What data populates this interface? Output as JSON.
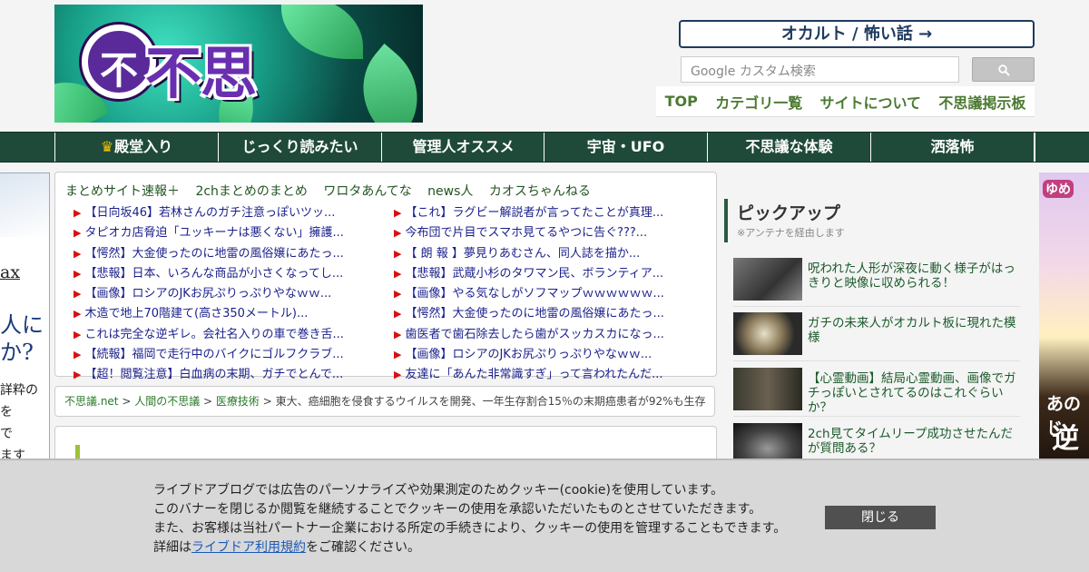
{
  "header": {
    "logo_text": "不思議.NET",
    "logo_glyph": "不",
    "occult_button": "オカルト / 怖い話 →",
    "search_placeholder": "Google カスタム検索",
    "topnav": [
      "TOP",
      "カテゴリ一覧",
      "サイトについて",
      "不思議掲示板"
    ]
  },
  "mainnav": [
    "殿堂入り",
    "じっくり読みたい",
    "管理人オススメ",
    "宇宙・UFO",
    "不思議な体験",
    "洒落怖"
  ],
  "left_ad": {
    "lines": [
      "ax",
      "人に",
      "か?",
      "詳粋の",
      "を",
      "で",
      "ます"
    ]
  },
  "antenna": {
    "tabs": [
      "まとめサイト速報＋",
      "2chまとめのまとめ",
      "ワロタあんてな",
      "news人",
      "カオスちゃんねる"
    ],
    "left": [
      "【日向坂46】若林さんのガチ注意っぽいツッ...",
      "タピオカ店脅迫「ユッキーナは悪くない」擁護...",
      "【愕然】大金使ったのに地雷の風俗嬢にあたっ...",
      "【悲報】日本、いろんな商品が小さくなってし...",
      "【画像】ロシアのJKお尻ぷりっぷりやなｗｗ...",
      "木造で地上70階建て(高さ350メートル)...",
      "これは完全な逆ギレ。会社名入りの車で巻き舌...",
      "【続報】福岡で走行中のバイクにゴルフクラブ...",
      "【超！閲覧注意】白血病の末期、ガチでとんで..."
    ],
    "right": [
      "【これ】ラグビー解説者が言ってたことが真理...",
      "今布団で片目でスマホ見てるやつに告ぐ???...",
      "【 朗 報 】夢見りあむさん、同人誌を描か...",
      "【悲報】武蔵小杉のタワマン民、ボランティア...",
      "【画像】やる気なしがソフマップｗｗｗｗｗｗ...",
      "【愕然】大金使ったのに地雷の風俗嬢にあたっ...",
      "歯医者で歯石除去したら歯がスッカスカになっ...",
      "【画像】ロシアのJKお尻ぷりっぷりやなｗｗ...",
      "友達に「あんた非常識すぎ」って言われたんだ..."
    ]
  },
  "breadcrumb": {
    "site": "不思議.net",
    "sep": " > ",
    "cat": "人間の不思議",
    "sub": "医療技術",
    "title": "東大、癌細胞を侵食するウイルスを開発、一年生存割合15％の末期癌患者が92%も生存"
  },
  "pickup": {
    "heading": "ピックアップ",
    "sub": "※アンテナを経由します",
    "items": [
      "呪われた人形が深夜に動く様子がはっきりと映像に収められる！",
      "ガチの未来人がオカルト板に現れた模様",
      "【心霊動画】結局心霊動画、画像でガチっぽいとされてるのはこれぐらいか？",
      "2ch見てタイムリープ成功させたんだが質問ある？"
    ]
  },
  "right_ad": {
    "top": "ゆめ",
    "big": "あのじ",
    "bottom": "逆"
  },
  "cookie": {
    "line1": "ライブドアブログでは広告のパーソナライズや効果測定のためクッキー(cookie)を使用しています。",
    "line2": "このバナーを閉じるか閲覧を継続することでクッキーの使用を承認いただいたものとさせていただきます。",
    "line3": "また、お客様は当社パートナー企業における所定の手続きにより、クッキーの使用を管理することもできます。",
    "line4_pre": "詳細は",
    "line4_link": "ライブドア利用規約",
    "line4_post": "をご確認ください。",
    "close": "閉じる"
  }
}
